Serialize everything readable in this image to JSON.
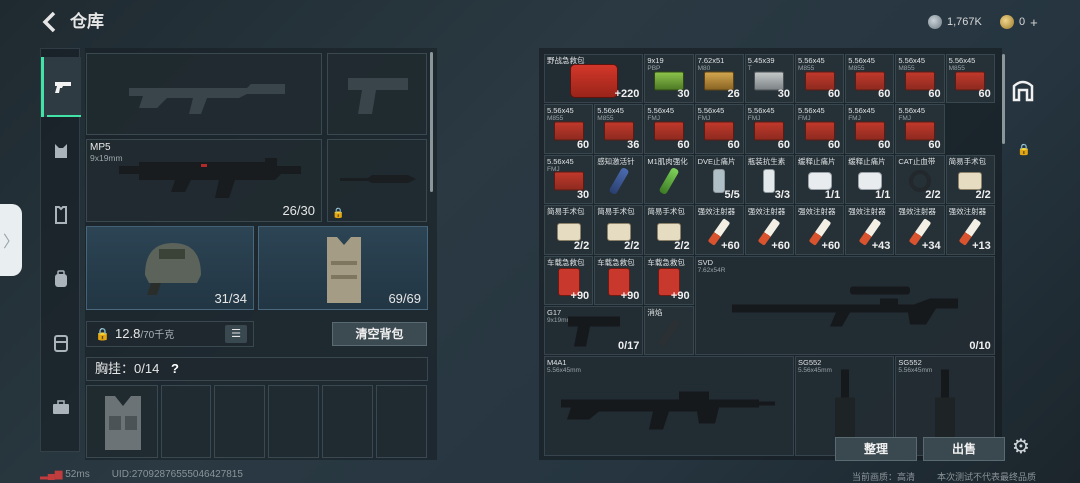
{
  "header": {
    "back_icon": "chevron-left-icon",
    "title": "仓库",
    "currency_1": "1,767K",
    "currency_2": "0",
    "plus": "+"
  },
  "tabs": [
    {
      "icon": "pistol-icon",
      "active": true
    },
    {
      "icon": "chest-rig-icon",
      "active": false
    },
    {
      "icon": "armor-icon",
      "active": false
    },
    {
      "icon": "backpack-icon",
      "active": false
    },
    {
      "icon": "container-icon",
      "active": false
    },
    {
      "icon": "toolbox-icon",
      "active": false
    }
  ],
  "equipment": {
    "primary": {
      "name": "MP5",
      "caliber": "9x19mm",
      "ammo": "26/30"
    },
    "helmet": {
      "durability": "31/34"
    },
    "armor": {
      "durability": "69/69"
    },
    "weight": {
      "current": "12.8",
      "max": "/70千克"
    },
    "clear_backpack": "清空背包",
    "chest_rig": {
      "label": "胸挂：0/14",
      "help": "?"
    }
  },
  "footer_left": {
    "ping": "52ms",
    "uid": "UID:27092876555046427815"
  },
  "storage": {
    "row1": [
      {
        "name": "野战急救包",
        "sub": "",
        "qty": "+220"
      },
      {
        "name": "9x19",
        "sub": "PBP",
        "qty": "30"
      },
      {
        "name": "7.62x51",
        "sub": "M80",
        "qty": "26"
      },
      {
        "name": "5.45x39",
        "sub": "T",
        "qty": "30"
      },
      {
        "name": "5.56x45",
        "sub": "M855",
        "qty": "60"
      },
      {
        "name": "5.56x45",
        "sub": "M855",
        "qty": "60"
      },
      {
        "name": "5.56x45",
        "sub": "M855",
        "qty": "60"
      },
      {
        "name": "5.56x45",
        "sub": "M855",
        "qty": "60"
      }
    ],
    "row2": [
      {
        "name": "5.56x45",
        "sub": "M855",
        "qty": "60"
      },
      {
        "name": "5.56x45",
        "sub": "M855",
        "qty": "36"
      },
      {
        "name": "5.56x45",
        "sub": "FMJ",
        "qty": "60"
      },
      {
        "name": "5.56x45",
        "sub": "FMJ",
        "qty": "60"
      },
      {
        "name": "5.56x45",
        "sub": "FMJ",
        "qty": "60"
      },
      {
        "name": "5.56x45",
        "sub": "FMJ",
        "qty": "60"
      },
      {
        "name": "5.56x45",
        "sub": "FMJ",
        "qty": "60"
      },
      {
        "name": "5.56x45",
        "sub": "FMJ",
        "qty": "60"
      }
    ],
    "row3": [
      {
        "name": "5.56x45",
        "sub": "FMJ",
        "qty": "30"
      },
      {
        "name": "感知激活针",
        "sub": "",
        "qty": ""
      },
      {
        "name": "M1肌肉强化",
        "sub": "",
        "qty": ""
      },
      {
        "name": "DVE止痛片",
        "sub": "",
        "qty": "5/5"
      },
      {
        "name": "瓶装抗生素",
        "sub": "",
        "qty": "3/3"
      },
      {
        "name": "缓释止痛片",
        "sub": "",
        "qty": "1/1"
      },
      {
        "name": "缓释止痛片",
        "sub": "",
        "qty": "1/1"
      },
      {
        "name": "CAT止血带",
        "sub": "",
        "qty": "2/2"
      },
      {
        "name": "简易手术包",
        "sub": "",
        "qty": "2/2"
      }
    ],
    "row4": [
      {
        "name": "简易手术包",
        "sub": "",
        "qty": "2/2"
      },
      {
        "name": "简易手术包",
        "sub": "",
        "qty": "2/2"
      },
      {
        "name": "简易手术包",
        "sub": "",
        "qty": "2/2"
      },
      {
        "name": "强效注射器",
        "sub": "",
        "qty": "+60"
      },
      {
        "name": "强效注射器",
        "sub": "",
        "qty": "+60"
      },
      {
        "name": "强效注射器",
        "sub": "",
        "qty": "+60"
      },
      {
        "name": "强效注射器",
        "sub": "",
        "qty": "+43"
      },
      {
        "name": "强效注射器",
        "sub": "",
        "qty": "+34"
      },
      {
        "name": "强效注射器",
        "sub": "",
        "qty": "+13"
      }
    ],
    "row5": [
      {
        "name": "车载急救包",
        "sub": "",
        "qty": "+90"
      },
      {
        "name": "车载急救包",
        "sub": "",
        "qty": "+90"
      },
      {
        "name": "车载急救包",
        "sub": "",
        "qty": "+90"
      }
    ],
    "svd": {
      "name": "SVD",
      "sub": "7.62x54R",
      "qty": "0/10"
    },
    "g17": {
      "name": "G17",
      "sub": "9x19mm",
      "qty": "0/17"
    },
    "suppressor": {
      "name": "消焰",
      "sub": "",
      "qty": ""
    },
    "m4a1": {
      "name": "M4A1",
      "sub": "5.56x45mm",
      "qty": ""
    },
    "sg552a": {
      "name": "SG552",
      "sub": "5.56x45mm",
      "qty": ""
    },
    "sg552b": {
      "name": "SG552",
      "sub": "5.56x45mm",
      "qty": ""
    }
  },
  "buttons": {
    "sort": "整理",
    "sell": "出售"
  },
  "footer_right": {
    "quality": "当前画质：高清",
    "note": "本次测试不代表最终品质"
  }
}
